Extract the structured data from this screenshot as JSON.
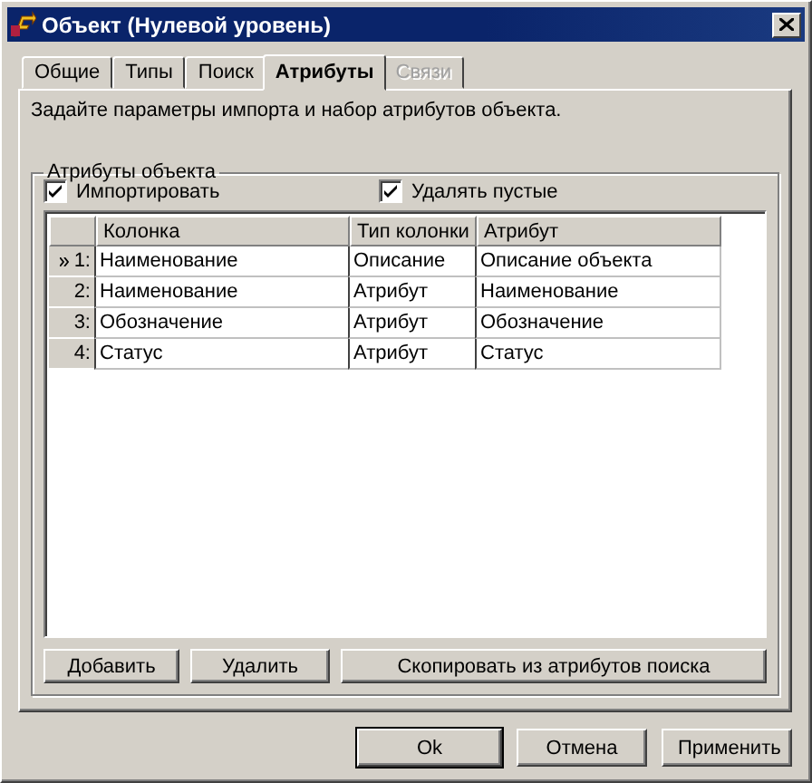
{
  "window": {
    "title": "Объект (Нулевой уровень)"
  },
  "tabs": [
    {
      "label": "Общие",
      "selected": false,
      "disabled": false
    },
    {
      "label": "Типы",
      "selected": false,
      "disabled": false
    },
    {
      "label": "Поиск",
      "selected": false,
      "disabled": false
    },
    {
      "label": "Атрибуты",
      "selected": true,
      "disabled": false
    },
    {
      "label": "Связи",
      "selected": false,
      "disabled": true
    }
  ],
  "description": "Задайте параметры импорта и набор атрибутов объекта.",
  "group": {
    "title": "Атрибуты объекта",
    "checkboxes": [
      {
        "label": "Импортировать",
        "checked": true
      },
      {
        "label": "Удалять пустые",
        "checked": true
      }
    ],
    "table": {
      "columns": [
        "Колонка",
        "Тип колонки",
        "Атрибут"
      ],
      "rows": [
        {
          "index": "1:",
          "selected": true,
          "cells": [
            "Наименование",
            "Описание",
            "Описание объекта"
          ]
        },
        {
          "index": "2:",
          "selected": false,
          "cells": [
            "Наименование",
            "Атрибут",
            "Наименование"
          ]
        },
        {
          "index": "3:",
          "selected": false,
          "cells": [
            "Обозначение",
            "Атрибут",
            "Обозначение"
          ]
        },
        {
          "index": "4:",
          "selected": false,
          "cells": [
            "Статус",
            "Атрибут",
            "Статус"
          ]
        }
      ]
    },
    "buttons": [
      "Добавить",
      "Удалить",
      "Скопировать из атрибутов поиска"
    ]
  },
  "buttons": [
    {
      "label": "Ok",
      "default": true
    },
    {
      "label": "Отмена",
      "default": false
    },
    {
      "label": "Применить",
      "default": false
    }
  ]
}
